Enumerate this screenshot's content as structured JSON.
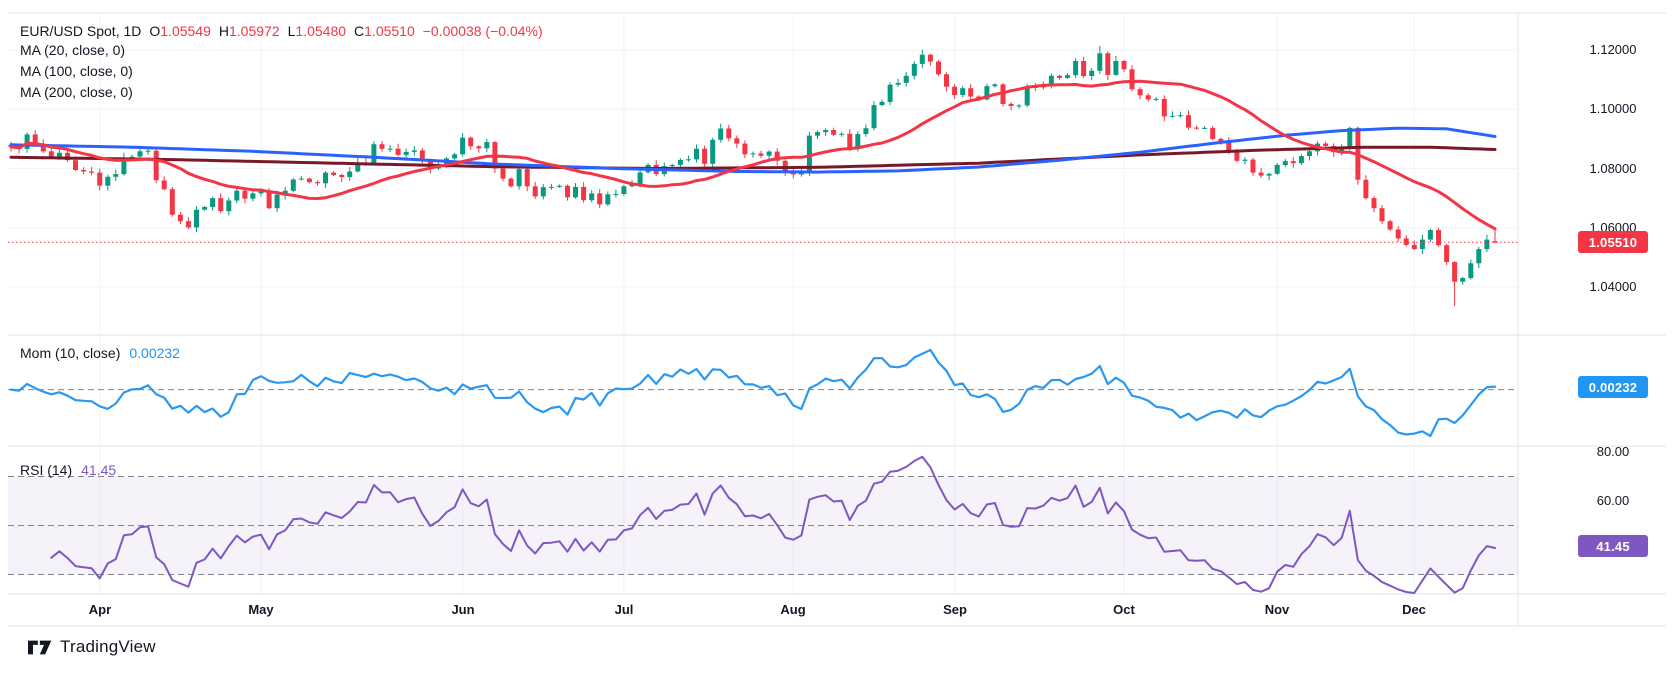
{
  "header": {
    "symbol_title": "EUR/USD Spot, 1D",
    "o_label": "O",
    "o_value": "1.05549",
    "h_label": "H",
    "h_value": "1.05972",
    "l_label": "L",
    "l_value": "1.05480",
    "c_label": "C",
    "c_value": "1.05510",
    "change": "−0.00038 (−0.04%)",
    "ma20_row": "MA (20, close, 0)",
    "ma100_row": "MA (100, close, 0)",
    "ma200_row": "MA (200, close, 0)"
  },
  "panes": {
    "mom": {
      "label": "Mom (10, close)",
      "value": "0.00232"
    },
    "rsi": {
      "label": "RSI (14)",
      "value": "41.45"
    }
  },
  "axis": {
    "price_labels": {
      "p0": "1.12000",
      "p1": "1.10000",
      "p2": "1.08000",
      "p3": "1.06000",
      "p4": "1.04000"
    },
    "price_badge": "1.05510",
    "mom_badge": "0.00232",
    "rsi_80": "80.00",
    "rsi_60": "60.00",
    "rsi_badge": "41.45"
  },
  "footer": {
    "brand": "TradingView"
  },
  "colors": {
    "up": "#089981",
    "down": "#f23645",
    "ma20": "#f23645",
    "ma100": "#2962ff",
    "ma200": "#771926",
    "mom_line": "#2b98f0",
    "rsi_line": "#7e57c2",
    "grid": "#f0f3fa",
    "divider": "#e0e3eb",
    "dash": "#80838e",
    "price_badge": "#f23645",
    "mom_badge": "#2196f3",
    "rsi_badge": "#7e57c2"
  },
  "chart_data": {
    "type": "candlestick",
    "symbol": "EUR/USD Spot",
    "interval": "1D",
    "last_bar": {
      "open": 1.05549,
      "high": 1.05972,
      "low": 1.0548,
      "close": 1.0551,
      "change": -0.00038,
      "change_pct": -0.04
    },
    "indicators": [
      {
        "name": "MA",
        "params": [
          20,
          "close",
          0
        ]
      },
      {
        "name": "MA",
        "params": [
          100,
          "close",
          0
        ]
      },
      {
        "name": "MA",
        "params": [
          200,
          "close",
          0
        ]
      },
      {
        "name": "Mom",
        "params": [
          10,
          "close"
        ],
        "last": 0.00232
      },
      {
        "name": "RSI",
        "params": [
          14
        ],
        "last": 41.45
      }
    ],
    "price_axis_values": [
      1.12,
      1.1,
      1.08,
      1.06,
      1.04
    ],
    "price_line": 1.0551,
    "rsi_axis_values": [
      80,
      60
    ],
    "rsi_guides": [
      70,
      50,
      30
    ],
    "month_ticks": [
      {
        "label": "Apr",
        "bar": 11
      },
      {
        "label": "May",
        "bar": 31
      },
      {
        "label": "Jun",
        "bar": 56
      },
      {
        "label": "Jul",
        "bar": 76
      },
      {
        "label": "Aug",
        "bar": 97
      },
      {
        "label": "Sep",
        "bar": 117
      },
      {
        "label": "Oct",
        "bar": 138
      },
      {
        "label": "Nov",
        "bar": 157
      },
      {
        "label": "Dec",
        "bar": 174
      }
    ],
    "closes": [
      1.0873,
      1.0866,
      1.0915,
      1.0884,
      1.0858,
      1.0838,
      1.0853,
      1.0828,
      1.0795,
      1.079,
      1.0786,
      1.0742,
      1.0772,
      1.0781,
      1.0837,
      1.084,
      1.0858,
      1.086,
      1.076,
      1.073,
      1.0644,
      1.0622,
      1.0601,
      1.0661,
      1.067,
      1.07,
      1.0656,
      1.0692,
      1.0725,
      1.0698,
      1.0716,
      1.0722,
      1.0666,
      1.0712,
      1.0725,
      1.0763,
      1.0766,
      1.0754,
      1.075,
      1.0786,
      1.0778,
      1.0771,
      1.079,
      1.082,
      1.0819,
      1.0882,
      1.0866,
      1.0867,
      1.0846,
      1.0856,
      1.0861,
      1.0828,
      1.08,
      1.0812,
      1.0834,
      1.0848,
      1.0904,
      1.0875,
      1.0868,
      1.0889,
      1.08,
      1.0766,
      1.074,
      1.0798,
      1.074,
      1.0706,
      1.0737,
      1.0738,
      1.0742,
      1.0703,
      1.0738,
      1.0693,
      1.0716,
      1.0679,
      1.0713,
      1.0714,
      1.074,
      1.0746,
      1.0787,
      1.0812,
      1.0781,
      1.0808,
      1.0812,
      1.0829,
      1.0831,
      1.0867,
      1.0816,
      1.0897,
      1.0935,
      1.0902,
      1.0884,
      1.0848,
      1.0851,
      1.0843,
      1.0857,
      1.0826,
      1.0787,
      1.078,
      1.0791,
      1.0911,
      1.0923,
      1.093,
      1.0914,
      1.0917,
      1.0866,
      1.0916,
      1.0936,
      1.1014,
      1.1025,
      1.1083,
      1.1089,
      1.1113,
      1.1153,
      1.1184,
      1.1161,
      1.1118,
      1.1076,
      1.1048,
      1.1071,
      1.1043,
      1.1033,
      1.1078,
      1.1084,
      1.1018,
      1.1011,
      1.1013,
      1.1075,
      1.1074,
      1.1084,
      1.1113,
      1.1106,
      1.1115,
      1.1163,
      1.1112,
      1.113,
      1.1189,
      1.1116,
      1.1163,
      1.1135,
      1.1068,
      1.1047,
      1.1033,
      1.1035,
      1.0976,
      1.0978,
      1.098,
      1.0938,
      1.0936,
      1.0937,
      1.09,
      1.089,
      1.0861,
      1.0826,
      1.083,
      1.0786,
      1.0776,
      1.0782,
      1.0812,
      1.0825,
      1.0818,
      1.0842,
      1.0858,
      1.0884,
      1.0876,
      1.0855,
      1.087,
      1.0937,
      1.0762,
      1.07,
      1.0666,
      1.0622,
      1.0594,
      1.0564,
      1.0542,
      1.0528,
      1.056,
      1.0592,
      1.0541,
      1.0484,
      1.0418,
      1.043,
      1.048,
      1.0528,
      1.056,
      1.0551
    ],
    "wick_overrides": {
      "22": {
        "l": 1.0595
      },
      "113": {
        "h": 1.1201
      },
      "135": {
        "h": 1.1214
      },
      "166": {
        "h": 1.0941
      },
      "179": {
        "l": 1.0335
      },
      "184": {
        "o": 1.05549,
        "h": 1.05972,
        "l": 1.0548
      }
    },
    "ma100_anchors": [
      [
        0,
        1.088
      ],
      [
        15,
        1.0872
      ],
      [
        30,
        1.0858
      ],
      [
        45,
        1.0838
      ],
      [
        60,
        1.0815
      ],
      [
        75,
        1.08
      ],
      [
        90,
        1.079
      ],
      [
        100,
        1.0788
      ],
      [
        110,
        1.0792
      ],
      [
        120,
        1.0805
      ],
      [
        130,
        1.0828
      ],
      [
        140,
        1.0855
      ],
      [
        150,
        1.0888
      ],
      [
        158,
        1.0912
      ],
      [
        165,
        1.0928
      ],
      [
        172,
        1.0936
      ],
      [
        178,
        1.0934
      ],
      [
        184,
        1.0908
      ]
    ],
    "ma200_anchors": [
      [
        0,
        1.0838
      ],
      [
        20,
        1.083
      ],
      [
        40,
        1.0818
      ],
      [
        60,
        1.0806
      ],
      [
        80,
        1.08
      ],
      [
        100,
        1.0804
      ],
      [
        120,
        1.0818
      ],
      [
        140,
        1.0846
      ],
      [
        155,
        1.0862
      ],
      [
        168,
        1.0872
      ],
      [
        176,
        1.0872
      ],
      [
        184,
        1.0864
      ]
    ]
  }
}
